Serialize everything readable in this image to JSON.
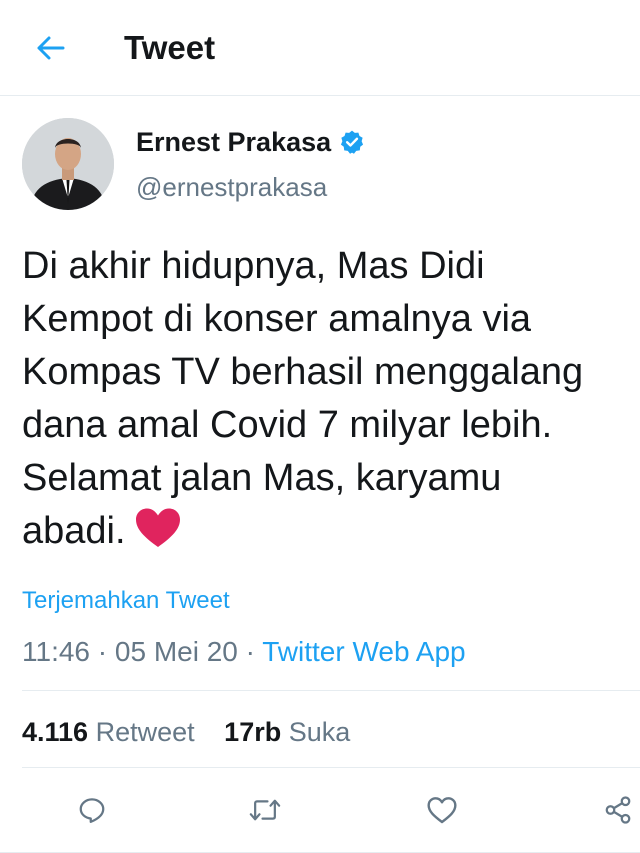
{
  "header": {
    "title": "Tweet",
    "back_icon": "arrow-left-icon"
  },
  "author": {
    "display_name": "Ernest Prakasa",
    "handle": "@ernestprakasa",
    "verified_icon": "verified-badge-icon"
  },
  "tweet": {
    "lines": [
      "Di akhir hidupnya, Mas Didi",
      "Kempot di konser amalnya via",
      "Kompas TV berhasil menggalang",
      "dana amal Covid 7 milyar lebih.",
      "Selamat jalan Mas, karyamu",
      "abadi."
    ],
    "emoji": "red-heart-emoji",
    "translate_label": "Terjemahkan Tweet",
    "time": "11:46",
    "date": "05 Mei 20",
    "separator": "·",
    "source": "Twitter Web App"
  },
  "stats": {
    "retweets_count": "4.116",
    "retweets_label": "Retweet",
    "likes_count": "17rb",
    "likes_label": "Suka"
  },
  "actions": [
    "reply-icon",
    "retweet-icon",
    "like-icon",
    "share-icon"
  ],
  "colors": {
    "accent": "#1da1f2",
    "text": "#14171a",
    "secondary": "#657786",
    "heart": "#e0245e",
    "divider": "#e6ecf0"
  }
}
